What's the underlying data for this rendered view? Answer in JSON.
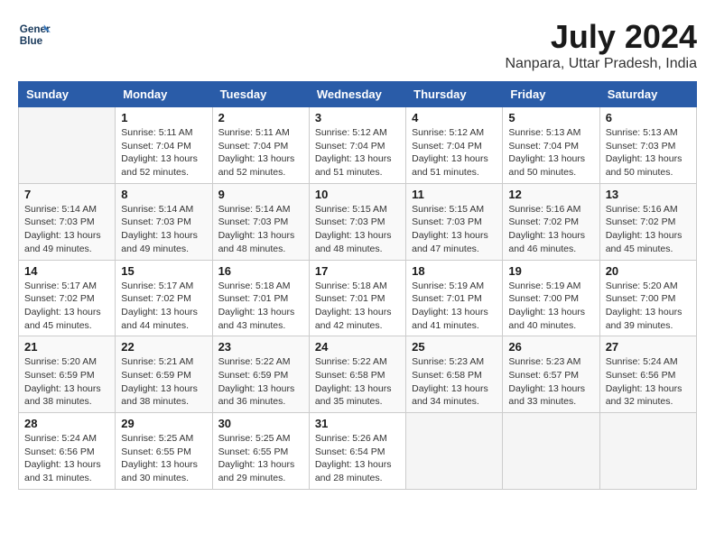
{
  "header": {
    "logo_line1": "General",
    "logo_line2": "Blue",
    "month_year": "July 2024",
    "location": "Nanpara, Uttar Pradesh, India"
  },
  "weekdays": [
    "Sunday",
    "Monday",
    "Tuesday",
    "Wednesday",
    "Thursday",
    "Friday",
    "Saturday"
  ],
  "weeks": [
    [
      {
        "day": "",
        "detail": ""
      },
      {
        "day": "1",
        "detail": "Sunrise: 5:11 AM\nSunset: 7:04 PM\nDaylight: 13 hours\nand 52 minutes."
      },
      {
        "day": "2",
        "detail": "Sunrise: 5:11 AM\nSunset: 7:04 PM\nDaylight: 13 hours\nand 52 minutes."
      },
      {
        "day": "3",
        "detail": "Sunrise: 5:12 AM\nSunset: 7:04 PM\nDaylight: 13 hours\nand 51 minutes."
      },
      {
        "day": "4",
        "detail": "Sunrise: 5:12 AM\nSunset: 7:04 PM\nDaylight: 13 hours\nand 51 minutes."
      },
      {
        "day": "5",
        "detail": "Sunrise: 5:13 AM\nSunset: 7:04 PM\nDaylight: 13 hours\nand 50 minutes."
      },
      {
        "day": "6",
        "detail": "Sunrise: 5:13 AM\nSunset: 7:03 PM\nDaylight: 13 hours\nand 50 minutes."
      }
    ],
    [
      {
        "day": "7",
        "detail": "Sunrise: 5:14 AM\nSunset: 7:03 PM\nDaylight: 13 hours\nand 49 minutes."
      },
      {
        "day": "8",
        "detail": "Sunrise: 5:14 AM\nSunset: 7:03 PM\nDaylight: 13 hours\nand 49 minutes."
      },
      {
        "day": "9",
        "detail": "Sunrise: 5:14 AM\nSunset: 7:03 PM\nDaylight: 13 hours\nand 48 minutes."
      },
      {
        "day": "10",
        "detail": "Sunrise: 5:15 AM\nSunset: 7:03 PM\nDaylight: 13 hours\nand 48 minutes."
      },
      {
        "day": "11",
        "detail": "Sunrise: 5:15 AM\nSunset: 7:03 PM\nDaylight: 13 hours\nand 47 minutes."
      },
      {
        "day": "12",
        "detail": "Sunrise: 5:16 AM\nSunset: 7:02 PM\nDaylight: 13 hours\nand 46 minutes."
      },
      {
        "day": "13",
        "detail": "Sunrise: 5:16 AM\nSunset: 7:02 PM\nDaylight: 13 hours\nand 45 minutes."
      }
    ],
    [
      {
        "day": "14",
        "detail": "Sunrise: 5:17 AM\nSunset: 7:02 PM\nDaylight: 13 hours\nand 45 minutes."
      },
      {
        "day": "15",
        "detail": "Sunrise: 5:17 AM\nSunset: 7:02 PM\nDaylight: 13 hours\nand 44 minutes."
      },
      {
        "day": "16",
        "detail": "Sunrise: 5:18 AM\nSunset: 7:01 PM\nDaylight: 13 hours\nand 43 minutes."
      },
      {
        "day": "17",
        "detail": "Sunrise: 5:18 AM\nSunset: 7:01 PM\nDaylight: 13 hours\nand 42 minutes."
      },
      {
        "day": "18",
        "detail": "Sunrise: 5:19 AM\nSunset: 7:01 PM\nDaylight: 13 hours\nand 41 minutes."
      },
      {
        "day": "19",
        "detail": "Sunrise: 5:19 AM\nSunset: 7:00 PM\nDaylight: 13 hours\nand 40 minutes."
      },
      {
        "day": "20",
        "detail": "Sunrise: 5:20 AM\nSunset: 7:00 PM\nDaylight: 13 hours\nand 39 minutes."
      }
    ],
    [
      {
        "day": "21",
        "detail": "Sunrise: 5:20 AM\nSunset: 6:59 PM\nDaylight: 13 hours\nand 38 minutes."
      },
      {
        "day": "22",
        "detail": "Sunrise: 5:21 AM\nSunset: 6:59 PM\nDaylight: 13 hours\nand 38 minutes."
      },
      {
        "day": "23",
        "detail": "Sunrise: 5:22 AM\nSunset: 6:59 PM\nDaylight: 13 hours\nand 36 minutes."
      },
      {
        "day": "24",
        "detail": "Sunrise: 5:22 AM\nSunset: 6:58 PM\nDaylight: 13 hours\nand 35 minutes."
      },
      {
        "day": "25",
        "detail": "Sunrise: 5:23 AM\nSunset: 6:58 PM\nDaylight: 13 hours\nand 34 minutes."
      },
      {
        "day": "26",
        "detail": "Sunrise: 5:23 AM\nSunset: 6:57 PM\nDaylight: 13 hours\nand 33 minutes."
      },
      {
        "day": "27",
        "detail": "Sunrise: 5:24 AM\nSunset: 6:56 PM\nDaylight: 13 hours\nand 32 minutes."
      }
    ],
    [
      {
        "day": "28",
        "detail": "Sunrise: 5:24 AM\nSunset: 6:56 PM\nDaylight: 13 hours\nand 31 minutes."
      },
      {
        "day": "29",
        "detail": "Sunrise: 5:25 AM\nSunset: 6:55 PM\nDaylight: 13 hours\nand 30 minutes."
      },
      {
        "day": "30",
        "detail": "Sunrise: 5:25 AM\nSunset: 6:55 PM\nDaylight: 13 hours\nand 29 minutes."
      },
      {
        "day": "31",
        "detail": "Sunrise: 5:26 AM\nSunset: 6:54 PM\nDaylight: 13 hours\nand 28 minutes."
      },
      {
        "day": "",
        "detail": ""
      },
      {
        "day": "",
        "detail": ""
      },
      {
        "day": "",
        "detail": ""
      }
    ]
  ]
}
